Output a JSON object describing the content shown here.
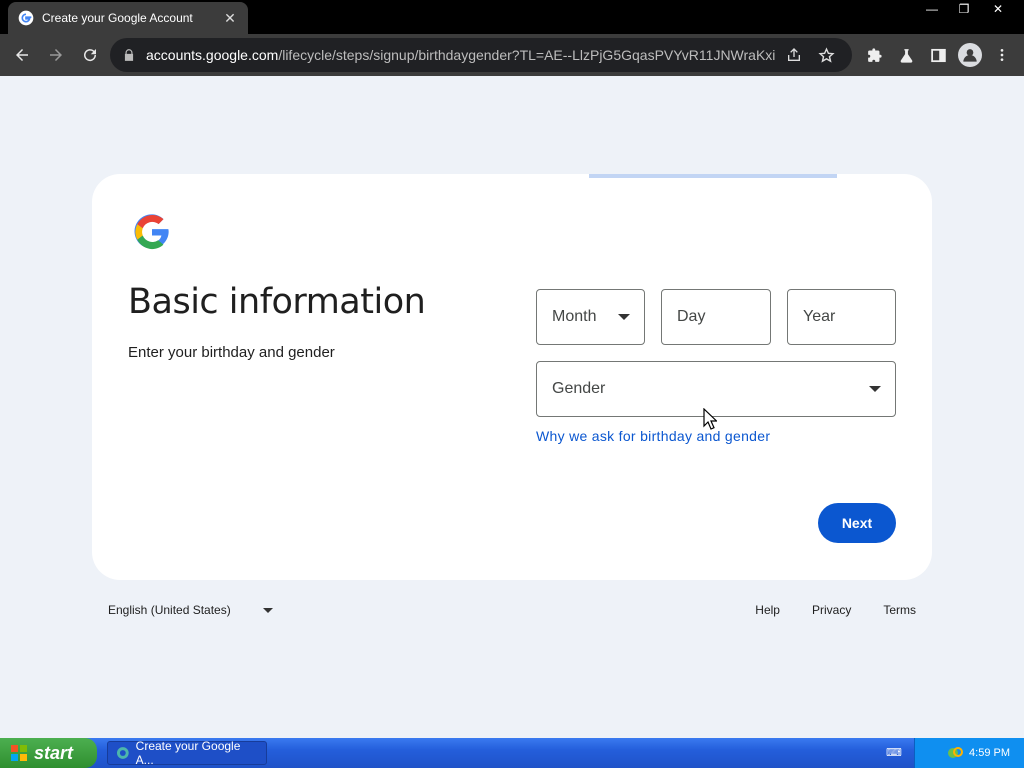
{
  "browser": {
    "tab_title": "Create your Google Account",
    "url_host": "accounts.google.com",
    "url_path": "/lifecycle/steps/signup/birthdaygender?TL=AE--LlzPjG5GqasPVYvR11JNWraKxi1u...",
    "window_controls": {
      "minimize": "—",
      "restore": "❐",
      "close": "✕"
    }
  },
  "page": {
    "heading": "Basic information",
    "subheading": "Enter your birthday and gender",
    "fields": {
      "month_placeholder": "Month",
      "day_placeholder": "Day",
      "year_placeholder": "Year",
      "gender_placeholder": "Gender"
    },
    "why_link": "Why we ask for birthday and gender",
    "next_label": "Next"
  },
  "footer": {
    "language": "English (United States)",
    "links": [
      "Help",
      "Privacy",
      "Terms"
    ]
  },
  "taskbar": {
    "start_label": "start",
    "task_label": "Create your Google A...",
    "clock": "4:59 PM"
  },
  "colors": {
    "accent": "#0b57d0",
    "page_bg": "#eef2f8"
  }
}
